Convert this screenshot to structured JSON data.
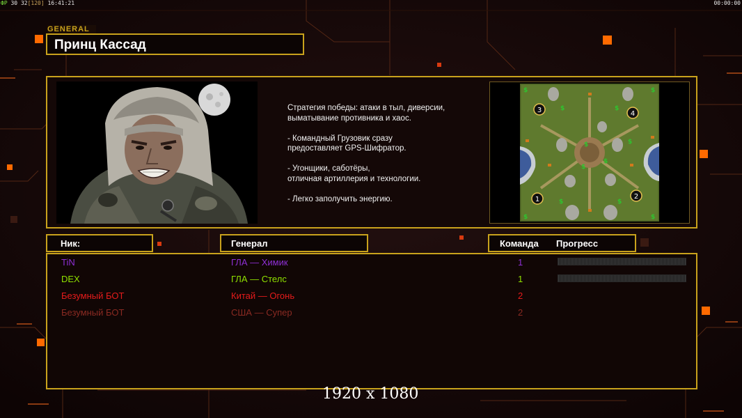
{
  "hud": {
    "fps_label": "ФР",
    "fps": "30",
    "fps2": "32",
    "fps_cap": "[120]",
    "clock": "16:41:21",
    "timer": "00:00:00"
  },
  "general": {
    "tag": "GENERAL",
    "name": "Принц Кассад"
  },
  "strategy_lines": [
    "Стратегия победы: атаки в тыл, диверсии,\n выматывание противника и хаос.",
    "- Командный Грузовик сразу\nпредоставляет GPS-Шифратор.",
    "- Угонщики, саботёры,\nотличная артиллерия и технологии.",
    "- Легко заполучить энергию."
  ],
  "map": {
    "start_positions": [
      "1",
      "2",
      "3",
      "4"
    ]
  },
  "columns": {
    "nick": "Ник:",
    "general": "Генерал",
    "team": "Команда",
    "progress": "Прогресс"
  },
  "players": [
    {
      "nick": "TiN",
      "general": "ГЛА — Химик",
      "team": "1",
      "color": "#8e2fd4",
      "progress": 0
    },
    {
      "nick": "DEX",
      "general": "ГЛА — Стелс",
      "team": "1",
      "color": "#8fe000",
      "progress": 0
    },
    {
      "nick": "Безумный БОТ",
      "general": "Китай — Огонь",
      "team": "2",
      "color": "#e51b1b",
      "progress": null
    },
    {
      "nick": "Безумный БОТ",
      "general": "США — Супер",
      "team": "2",
      "color": "#8a2a22",
      "progress": null
    }
  ],
  "resolution": "1920 x 1080",
  "colors": {
    "accent_gold": "#c9a21c",
    "background": "#130706",
    "glow_orange": "#ff6a00"
  }
}
